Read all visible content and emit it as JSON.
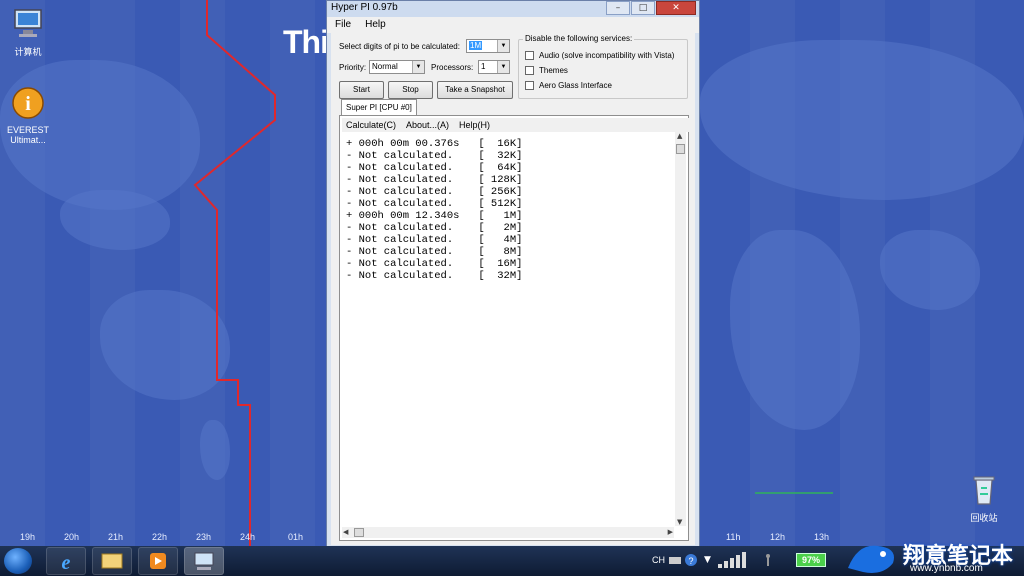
{
  "desktop": {
    "icons": [
      {
        "label": "计算机"
      },
      {
        "label": "EVEREST\nUltimat..."
      },
      {
        "label": "回收站"
      }
    ],
    "hours": [
      "19h",
      "20h",
      "21h",
      "22h",
      "23h",
      "24h",
      "01h",
      "11h",
      "12h",
      "13h"
    ],
    "logo_text": "Thi"
  },
  "window": {
    "title": "Hyper PI 0.97b",
    "menu": [
      "File",
      "Help"
    ],
    "digits_label": "Select digits of pi to be calculated:",
    "digits_value": "1M",
    "priority_label": "Priority:",
    "priority_value": "Normal",
    "processors_label": "Processors:",
    "processors_value": "1",
    "buttons": {
      "start": "Start",
      "stop": "Stop",
      "snapshot": "Take a Snapshot"
    },
    "services_title": "Disable the following services:",
    "services": [
      {
        "label": "Audio (solve incompatibility with Vista)",
        "checked": false
      },
      {
        "label": "Themes",
        "checked": false
      },
      {
        "label": "Aero Glass Interface",
        "checked": false
      }
    ],
    "tab_label": "Super PI [CPU #0]",
    "inner_menu": [
      "Calculate(C)",
      "About...(A)",
      "Help(H)"
    ],
    "results": [
      "+ 000h 00m 00.376s   [  16K]",
      "- Not calculated.    [  32K]",
      "- Not calculated.    [  64K]",
      "- Not calculated.    [ 128K]",
      "- Not calculated.    [ 256K]",
      "- Not calculated.    [ 512K]",
      "+ 000h 00m 12.340s   [   1M]",
      "- Not calculated.    [   2M]",
      "- Not calculated.    [   4M]",
      "- Not calculated.    [   8M]",
      "- Not calculated.    [  16M]",
      "- Not calculated.    [  32M]"
    ]
  },
  "taskbar": {
    "lang": "CH",
    "battery": "97%",
    "watermark_text": "翔意笔记本",
    "watermark_url": "www.ynbnb.com"
  },
  "colors": {
    "wallpaper": "#3a5ab4",
    "dateline": "#e0282c",
    "highlight": "#3399ff"
  }
}
